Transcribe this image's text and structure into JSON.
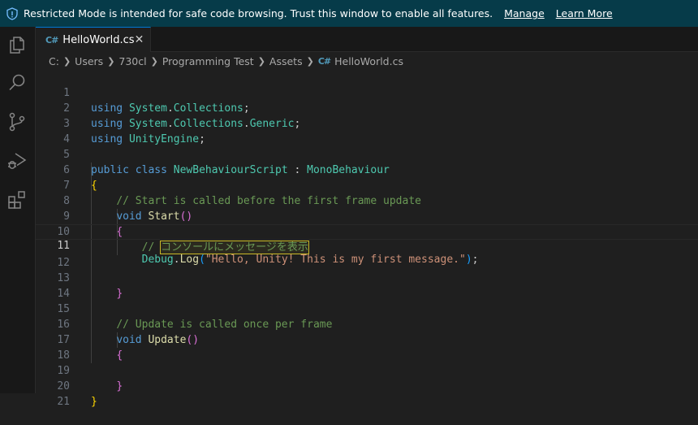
{
  "banner": {
    "message": "Restricted Mode is intended for safe code browsing. Trust this window to enable all features.",
    "manage_label": "Manage",
    "learn_more_label": "Learn More",
    "bg_color": "#063b49"
  },
  "activity_bar": {
    "icons": [
      "explorer-icon",
      "search-icon",
      "source-control-icon",
      "run-debug-icon",
      "extensions-icon"
    ]
  },
  "tabs": [
    {
      "label": "HelloWorld.cs",
      "icon": "csharp-file-icon",
      "active": true
    }
  ],
  "breadcrumb": {
    "items": [
      "C:",
      "Users",
      "730cl",
      "Programming Test",
      "Assets"
    ],
    "file": "HelloWorld.cs"
  },
  "editor": {
    "current_line": 11,
    "line_numbers": [
      "1",
      "2",
      "3",
      "4",
      "5",
      "6",
      "7",
      "8",
      "9",
      "10",
      "11",
      "12",
      "13",
      "14",
      "15",
      "16",
      "17",
      "18",
      "19",
      "20",
      "21"
    ],
    "tokens": {
      "using": "using",
      "ns1_a": "System",
      "ns1_b": ".",
      "ns1_c": "Collections",
      "semi": ";",
      "ns2_c": "Collections",
      "ns2_d": "Generic",
      "ns3": "UnityEngine",
      "public": "public",
      "class": "class",
      "class_name": "NewBehaviourScript",
      "colon": " : ",
      "base_class": "MonoBehaviour",
      "brace_open": "{",
      "brace_close": "}",
      "comment_start": "// Start is called before the first frame update",
      "void": "void",
      "start_fn": "Start",
      "paren_open": "(",
      "paren_close": ")",
      "comment_jp_slashes": "// ",
      "comment_jp_text": "コンソールにメッセージを表示",
      "debug": "Debug",
      "dot": ".",
      "log": "Log",
      "message": "\"Hello, Unity! This is my first message.\"",
      "comment_update": "// Update is called once per frame",
      "update_fn": "Update"
    }
  }
}
